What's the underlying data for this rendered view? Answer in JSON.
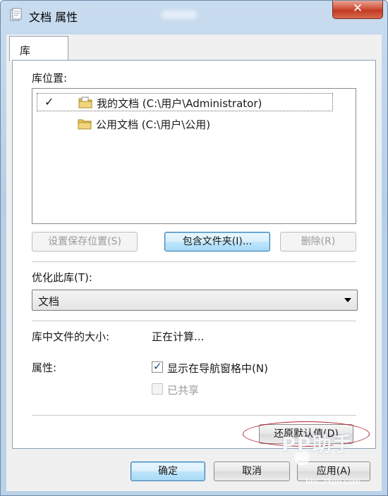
{
  "window": {
    "title": "文档 属性",
    "close_glyph": "✕"
  },
  "tabs": [
    {
      "label": "库"
    }
  ],
  "library": {
    "locations_label": "库位置:",
    "locations": [
      {
        "check": "✓",
        "name": "我的文档 (C:\\用户\\Administrator)",
        "selected": true
      },
      {
        "check": "",
        "name": "公用文档 (C:\\用户\\公用)",
        "selected": false
      }
    ],
    "buttons": {
      "set_save_location": "设置保存位置(S)",
      "include_folder": "包含文件夹(I)...",
      "remove": "删除(R)"
    },
    "optimize_label": "优化此库(T):",
    "optimize_value": "文档",
    "size_label": "库中文件的大小:",
    "size_value": "正在计算...",
    "attributes_label": "属性:",
    "show_in_nav": {
      "label": "显示在导航窗格中(N)",
      "checked": true
    },
    "shared": {
      "label": "已共享",
      "checked": false,
      "enabled": false
    },
    "restore_defaults": "还原默认值(D)"
  },
  "footer": {
    "ok": "确定",
    "cancel": "取消",
    "apply": "应用(A)"
  },
  "watermark": {
    "text": "PP助手",
    "url": "bbs.25pp.com"
  },
  "colors": {
    "highlight_ring": "#b0202a",
    "close_button": "#c23a22",
    "window_frame": "#b7cfe6"
  }
}
